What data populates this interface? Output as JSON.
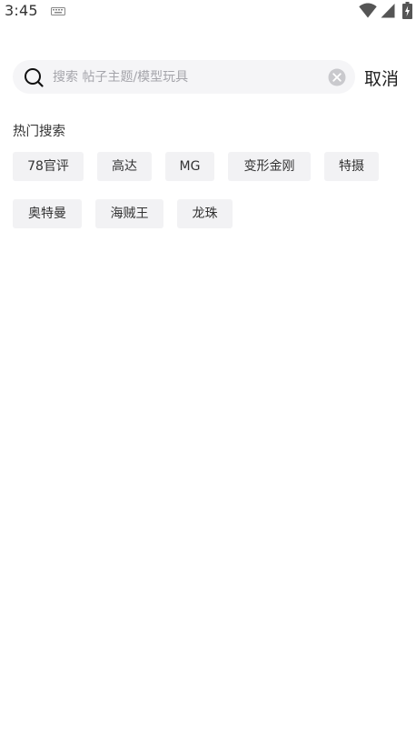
{
  "status_bar": {
    "time": "3:45",
    "icons": [
      "keyboard-icon",
      "wifi-icon",
      "cell-signal-icon",
      "battery-charging-icon"
    ]
  },
  "search": {
    "placeholder": "搜索 帖子主题/模型玩具",
    "value": "",
    "icons": [
      "search-icon",
      "clear-icon"
    ]
  },
  "cancel_label": "取消",
  "hot_search": {
    "title": "热门搜索",
    "tags": [
      "78官评",
      "高达",
      "MG",
      "变形金刚",
      "特摄",
      "奥特曼",
      "海贼王",
      "龙珠"
    ]
  },
  "colors": {
    "search_bg": "#f5f5f7",
    "tag_bg": "#f2f2f4",
    "placeholder": "#a5a5ab",
    "text": "#333333"
  }
}
